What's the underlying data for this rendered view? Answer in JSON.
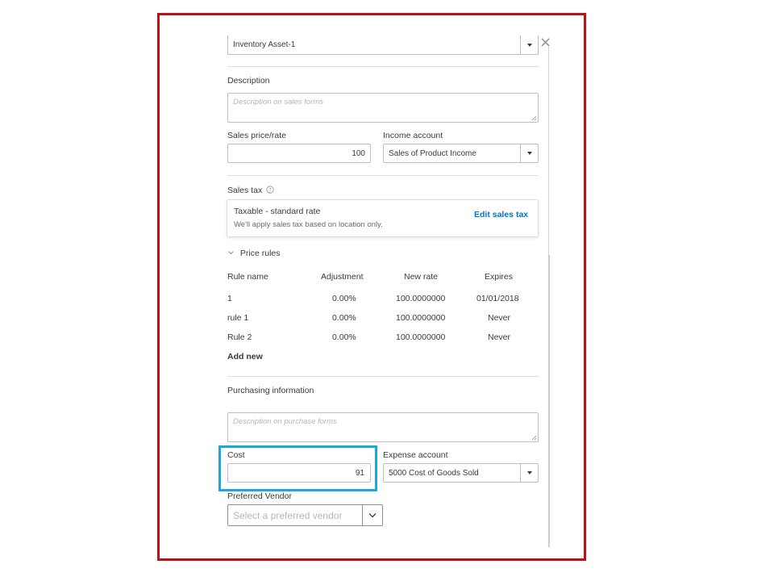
{
  "inventory_asset": {
    "value": "Inventory Asset-1"
  },
  "description": {
    "label": "Description",
    "placeholder": "Description on sales forms"
  },
  "sales_price": {
    "label": "Sales price/rate",
    "value": "100"
  },
  "income_account": {
    "label": "Income account",
    "value": "Sales of Product Income"
  },
  "sales_tax": {
    "label": "Sales tax",
    "status": "Taxable - standard rate",
    "note": "We'll apply sales tax based on location only.",
    "edit_label": "Edit sales tax"
  },
  "price_rules": {
    "toggle_label": "Price rules",
    "headers": [
      "Rule name",
      "Adjustment",
      "New rate",
      "Expires"
    ],
    "rows": [
      {
        "name": "1",
        "adjustment": "0.00%",
        "new_rate": "100.0000000",
        "expires": "01/01/2018"
      },
      {
        "name": "rule 1",
        "adjustment": "0.00%",
        "new_rate": "100.0000000",
        "expires": "Never"
      },
      {
        "name": "Rule 2",
        "adjustment": "0.00%",
        "new_rate": "100.0000000",
        "expires": "Never"
      }
    ],
    "add_new_label": "Add new"
  },
  "purchasing": {
    "label": "Purchasing information",
    "placeholder": "Description on purchase forms"
  },
  "cost": {
    "label": "Cost",
    "value": "91"
  },
  "expense_account": {
    "label": "Expense account",
    "value": "5000 Cost of Goods Sold"
  },
  "preferred_vendor": {
    "label": "Preferred Vendor",
    "placeholder": "Select a preferred vendor"
  },
  "colors": {
    "frame": "#b81316",
    "highlight": "#1aa7df",
    "link": "#0077c5"
  },
  "icons": {
    "close": "close-icon",
    "dropdown": "caret-down-icon",
    "help": "help-circle-icon",
    "chevron": "chevron-down-icon"
  }
}
